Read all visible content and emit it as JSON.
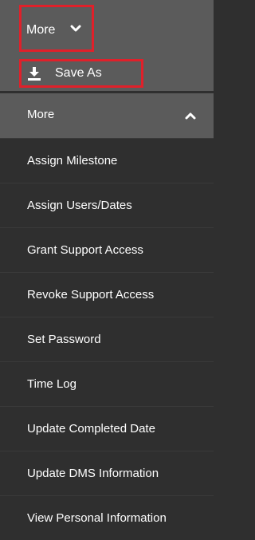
{
  "top_menu": {
    "label": "More",
    "icon": "chevron-down-icon"
  },
  "save_as": {
    "label": "Save As",
    "icon": "download-icon"
  },
  "more_section": {
    "label": "More",
    "icon": "chevron-up-icon"
  },
  "menu_items": [
    {
      "label": "Assign Milestone"
    },
    {
      "label": "Assign Users/Dates"
    },
    {
      "label": "Grant Support Access"
    },
    {
      "label": "Revoke Support Access"
    },
    {
      "label": "Set Password"
    },
    {
      "label": "Time Log"
    },
    {
      "label": "Update Completed Date"
    },
    {
      "label": "Update DMS Information"
    },
    {
      "label": "View Personal Information"
    }
  ],
  "colors": {
    "background": "#2f2f2f",
    "header": "#5b5b5b",
    "highlight": "#e0202a",
    "text": "#ffffff"
  }
}
